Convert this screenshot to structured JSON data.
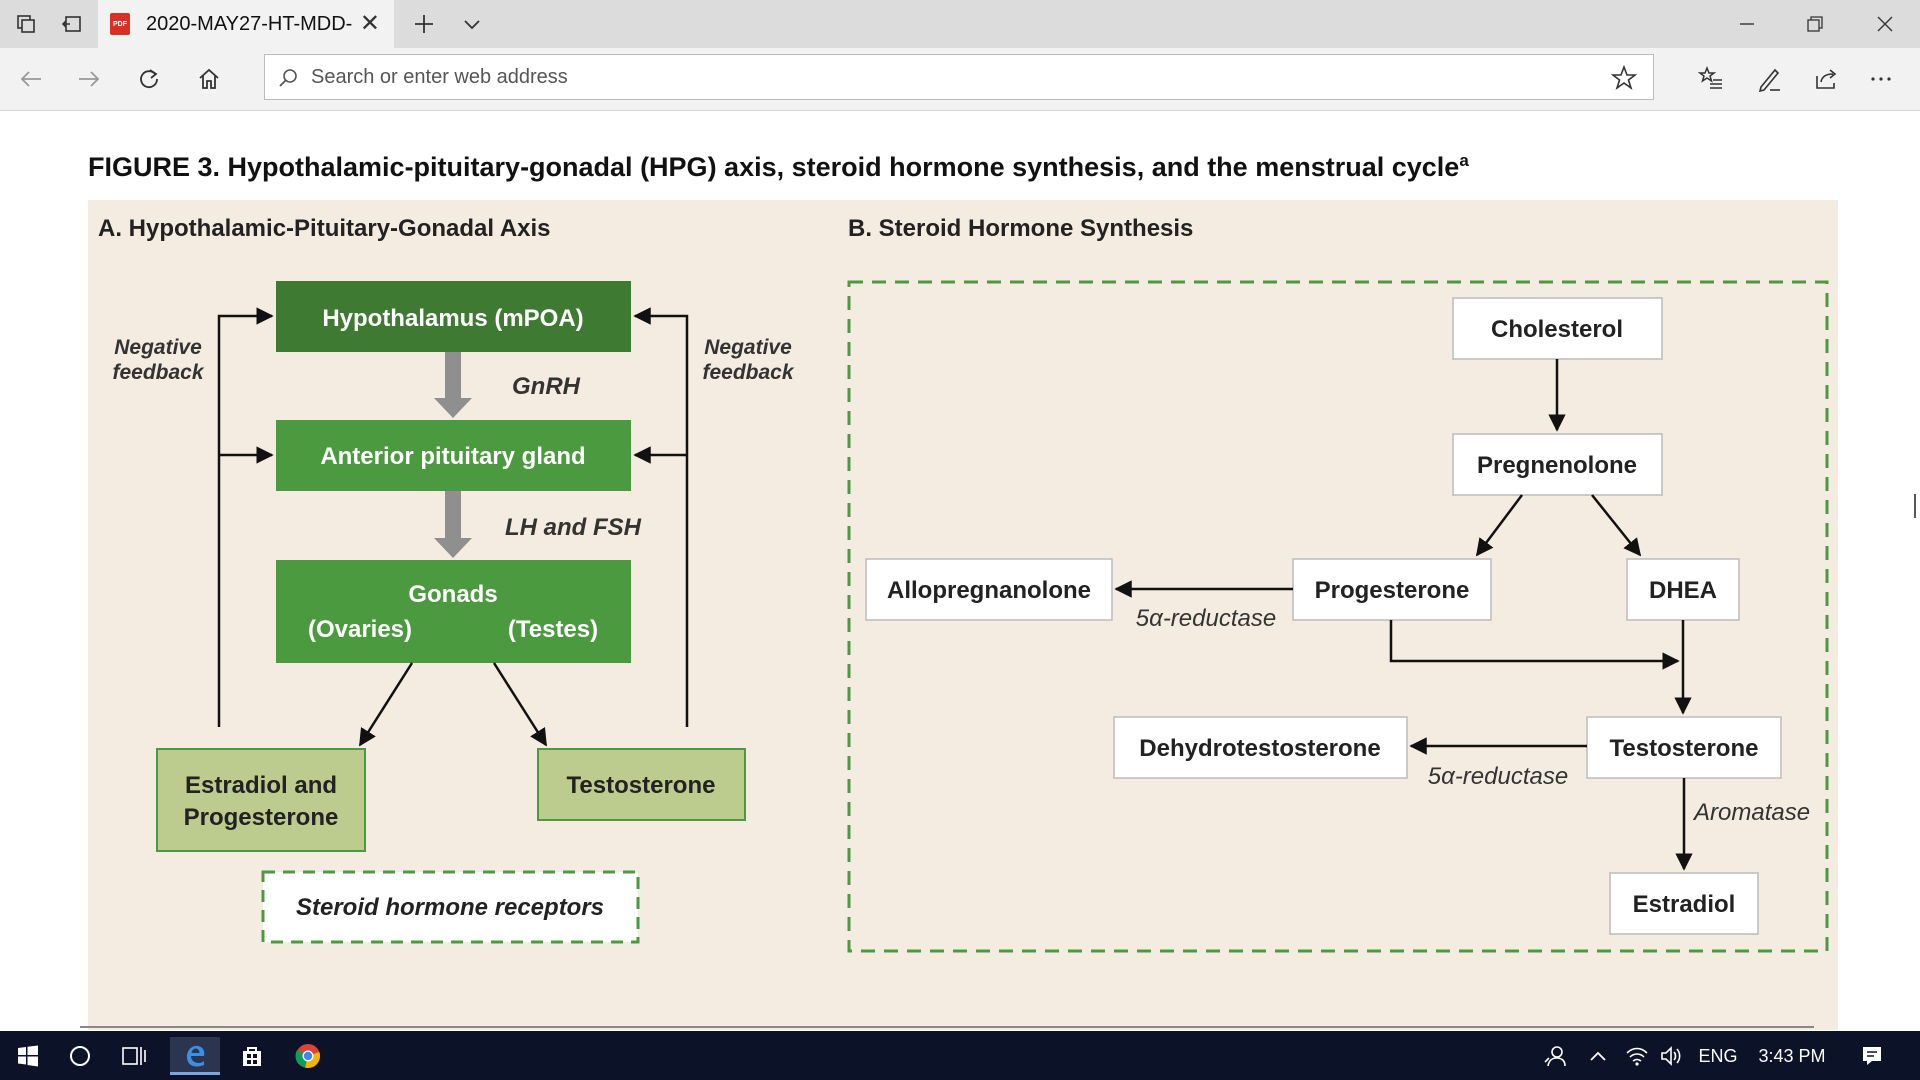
{
  "browser": {
    "tab_title": "2020-MAY27-HT-MDD-",
    "tab_file_badge": "PDF",
    "address_placeholder": "Search or enter web address"
  },
  "figure": {
    "caption": "FIGURE 3.  Hypothalamic-pituitary-gonadal (HPG) axis, steroid hormone synthesis, and the menstrual cycle",
    "caption_sup": "a",
    "panel_a": {
      "title": "A. Hypothalamic-Pituitary-Gonadal Axis",
      "hypothalamus": "Hypothalamus (mPOA)",
      "gnrh": "GnRH",
      "pituitary": "Anterior pituitary gland",
      "lh_fsh": "LH and FSH",
      "gonads": "Gonads",
      "ovaries": "(Ovaries)",
      "testes": "(Testes)",
      "estradiol_line1": "Estradiol and",
      "estradiol_line2": "Progesterone",
      "testosterone": "Testosterone",
      "receptors": "Steroid hormone receptors",
      "neg_fb_line1": "Negative",
      "neg_fb_line2": "feedback"
    },
    "panel_b": {
      "title": "B. Steroid Hormone Synthesis",
      "cholesterol": "Cholesterol",
      "pregnenolone": "Pregnenolone",
      "allopregnanolone": "Allopregnanolone",
      "progesterone": "Progesterone",
      "dhea": "DHEA",
      "dihydrotestosterone": "Dehydrotestosterone",
      "testosterone": "Testosterone",
      "estradiol": "Estradiol",
      "reductase": "5α-reductase",
      "aromatase": "Aromatase"
    }
  },
  "taskbar": {
    "language": "ENG",
    "time": "3:43 PM"
  },
  "colors": {
    "panel_bg": "#f4ece0",
    "dark_green": "#3f7a33",
    "green": "#4c9a3f",
    "light_green": "#bccb8e",
    "gray_arrow": "#8f8f8f",
    "dashed_green": "#4c9a3f"
  }
}
